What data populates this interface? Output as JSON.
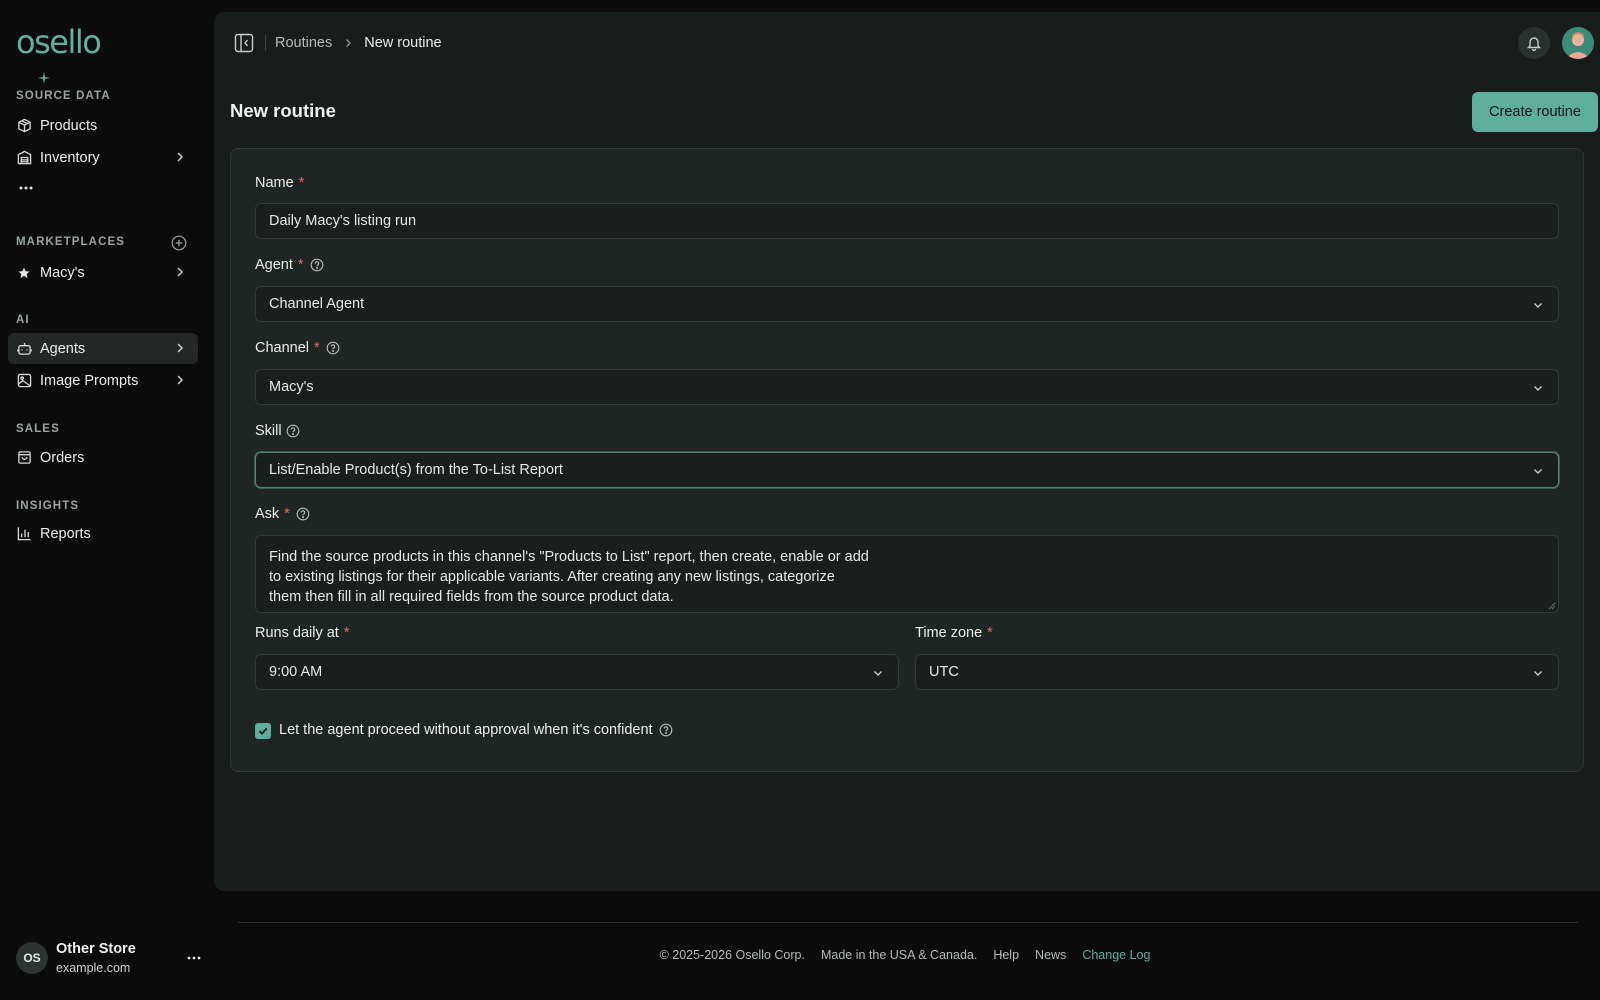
{
  "app": {
    "logo_text": "osello"
  },
  "sidebar": {
    "sections": {
      "source_data": "SOURCE DATA",
      "marketplaces": "MARKETPLACES",
      "ai": "AI",
      "sales": "SALES",
      "insights": "INSIGHTS"
    },
    "items": {
      "products": "Products",
      "inventory": "Inventory",
      "macys": "Macy's",
      "agents": "Agents",
      "image_prompts": "Image Prompts",
      "orders": "Orders",
      "reports": "Reports"
    },
    "active_item": "Agents",
    "store": {
      "initials": "OS",
      "name": "Other Store",
      "domain": "example.com"
    }
  },
  "header": {
    "breadcrumb_parent": "Routines",
    "breadcrumb_current": "New routine"
  },
  "page": {
    "title": "New routine",
    "create_button": "Create routine"
  },
  "form": {
    "name": {
      "label": "Name",
      "required": "*",
      "value": "Daily Macy's listing run"
    },
    "agent": {
      "label": "Agent",
      "required": "*",
      "value": "Channel Agent"
    },
    "channel": {
      "label": "Channel",
      "required": "*",
      "value": "Macy's"
    },
    "skill": {
      "label": "Skill",
      "value": "List/Enable Product(s) from the To-List Report"
    },
    "ask": {
      "label": "Ask",
      "required": "*",
      "lines": [
        "Find the source products in this channel's \"Products to List\" report, then create, enable or add",
        "to existing listings for their applicable variants. After creating any new listings, categorize",
        "them then fill in all required fields from the source product data."
      ]
    },
    "runs_daily_at": {
      "label": "Runs daily at",
      "required": "*",
      "value": "9:00 AM"
    },
    "time_zone": {
      "label": "Time zone",
      "required": "*",
      "value": "UTC"
    },
    "auto_approve": {
      "label": "Let the agent proceed without approval when it's confident",
      "checked": true
    }
  },
  "footer": {
    "copyright": "© 2025-2026 Osello Corp.",
    "made_in": "Made in the USA & Canada.",
    "help": "Help",
    "news": "News",
    "changelog": "Change Log"
  },
  "colors": {
    "accent": "#5fae9c",
    "background": "#0b0b0b",
    "panel": "#181d1b",
    "card": "#1f2523",
    "required": "#e26a6a"
  }
}
